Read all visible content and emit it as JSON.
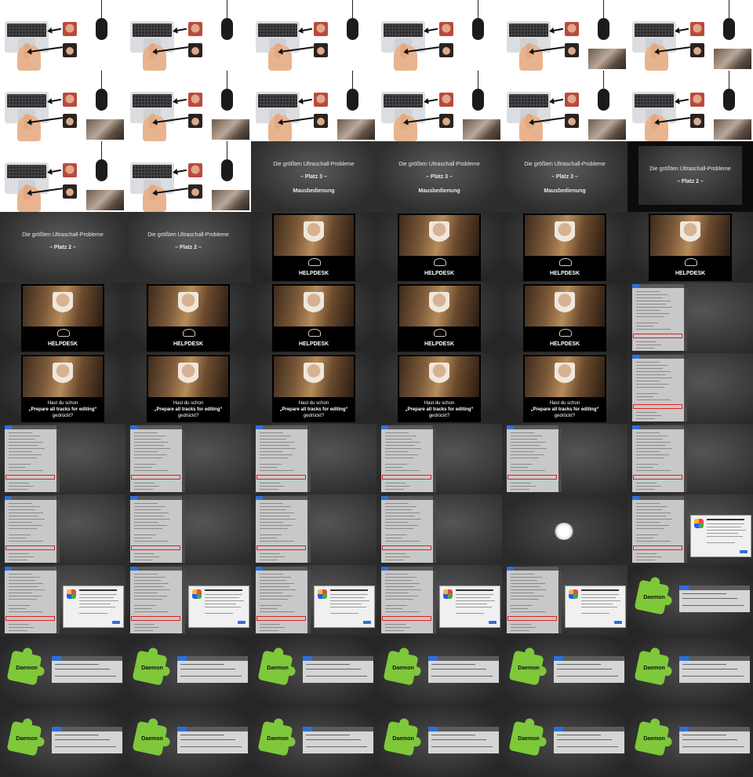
{
  "title_slides": {
    "heading": "Die größten Ultraschall-Probleme",
    "rank3": "– Platz 3 –",
    "rank3_topic": "Mausbedienung",
    "rank2": "– Platz 2 –"
  },
  "helpdesk": {
    "label": "HELPDESK",
    "question_line1": "Hast du schon",
    "question_line2": "„Prepare all tracks for editing“",
    "question_line3": "gedrückt?"
  },
  "daemon": {
    "label": "Daemon"
  },
  "cells": [
    "laptop",
    "laptop",
    "laptop",
    "laptop",
    "laptop-cat",
    "laptop-cat",
    "laptop-cat",
    "laptop-cat",
    "laptop-cat",
    "laptop-cat",
    "laptop-cat",
    "laptop-cat",
    "laptop-cat",
    "laptop-cat",
    "title3",
    "title3",
    "title3",
    "title2-framed",
    "title2",
    "title2",
    "helpdesk",
    "helpdesk",
    "helpdesk",
    "helpdesk",
    "helpdesk",
    "helpdesk",
    "helpdesk",
    "helpdesk",
    "helpdesk",
    "menu",
    "ask",
    "ask",
    "ask",
    "ask",
    "ask",
    "menu",
    "menu",
    "menu",
    "menu",
    "menu",
    "menu",
    "menu",
    "menu",
    "menu",
    "menu",
    "menu",
    "spot",
    "menu-dialog",
    "menu-dialog",
    "menu-dialog",
    "menu-dialog",
    "menu-dialog",
    "menu-dialog",
    "daemon",
    "daemon",
    "daemon",
    "daemon",
    "daemon",
    "daemon",
    "daemon",
    "daemon",
    "daemon",
    "daemon",
    "daemon",
    "daemon",
    "daemon"
  ]
}
